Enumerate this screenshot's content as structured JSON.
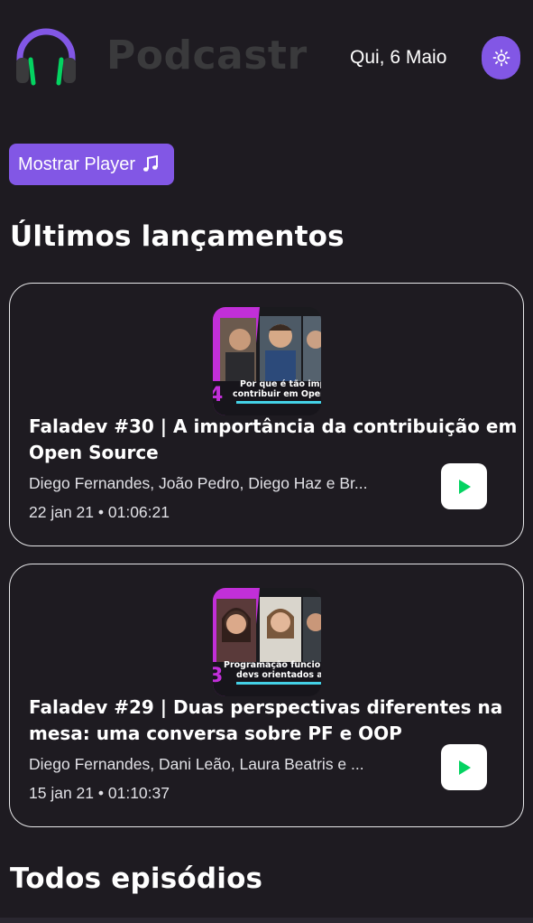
{
  "header": {
    "brand": "Podcastr",
    "date": "Qui, 6 Maio",
    "theme_icon": "sun-icon",
    "logo_icon": "headphones-icon"
  },
  "player_button": {
    "label": "Mostrar Player",
    "icon": "music-note-icon"
  },
  "latest_section": {
    "title": "Últimos lançamentos"
  },
  "episodes": [
    {
      "title": "Faladev #30 | A importância da contribuição em Open Source",
      "members": "Diego Fernandes, João Pedro, Diego Haz e Br...",
      "published": "22 jan 21",
      "duration": "01:06:21",
      "thumbnail_number": "4",
      "thumbnail_caption_1": "Por que é tão imp",
      "thumbnail_caption_2": "contribuir em Open S"
    },
    {
      "title": "Faladev #29 | Duas perspectivas diferentes na mesa: uma conversa sobre PF e OOP",
      "members": "Diego Fernandes, Dani Leão, Laura Beatris e ...",
      "published": "15 jan 21",
      "duration": "01:10:37",
      "thumbnail_number": "3",
      "thumbnail_caption_1": "Programação funcion",
      "thumbnail_caption_2": "devs orientados a o"
    }
  ],
  "all_section": {
    "title": "Todos episódios"
  },
  "colors": {
    "background": "#1e1b21",
    "accent": "#8257e5",
    "play_green": "#04d361",
    "brand_text": "#3a3a3c"
  }
}
